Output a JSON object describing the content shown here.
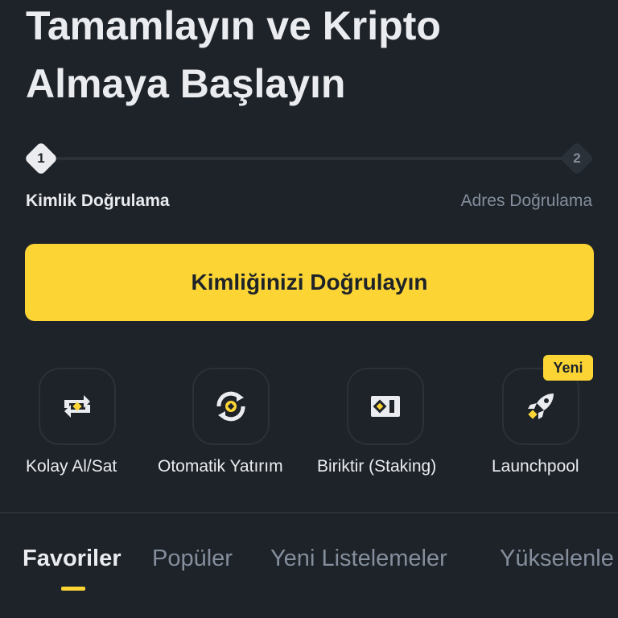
{
  "title_lines": [
    "Tamamlayın ve Kripto",
    "Almaya Başlayın"
  ],
  "stepper": {
    "steps": [
      {
        "number": "1",
        "label": "Kimlik Doğrulama",
        "state": "active"
      },
      {
        "number": "2",
        "label": "Adres Doğrulama",
        "state": "inactive"
      }
    ]
  },
  "cta": {
    "label": "Kimliğinizi Doğrulayın",
    "color": "#fcd535"
  },
  "shortcuts": [
    {
      "label": "Kolay Al/Sat",
      "icon": "swap-icon"
    },
    {
      "label": "Otomatik Yatırım",
      "icon": "auto-invest-icon"
    },
    {
      "label": "Biriktir (Staking)",
      "icon": "staking-icon"
    },
    {
      "label": "Launchpool",
      "icon": "rocket-icon",
      "badge": "Yeni"
    }
  ],
  "tabs": [
    {
      "label": "Favoriler",
      "active": true
    },
    {
      "label": "Popüler",
      "active": false
    },
    {
      "label": "Yeni Listelemeler",
      "active": false
    },
    {
      "label": "Yükselenle",
      "active": false
    }
  ],
  "colors": {
    "background": "#1e2329",
    "accent": "#fcd535",
    "text": "#eaecef",
    "muted": "#848e9c"
  }
}
